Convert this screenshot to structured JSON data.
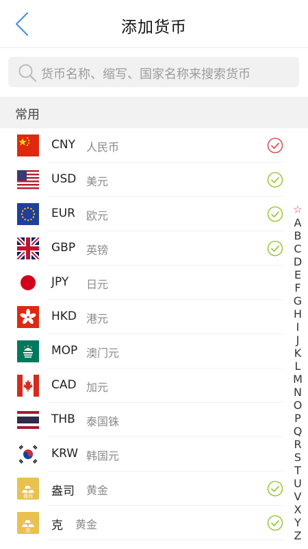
{
  "header": {
    "title": "添加货币"
  },
  "search": {
    "placeholder": "货币名称、缩写、国家名称来搜索货币"
  },
  "section": {
    "common_label": "常用"
  },
  "currencies": [
    {
      "code": "CNY",
      "name": "人民币",
      "flag": "cn-flag-icon",
      "selected": true,
      "check_color": "#d9534f"
    },
    {
      "code": "USD",
      "name": "美元",
      "flag": "us-flag-icon",
      "selected": true,
      "check_color": "#9cc93f"
    },
    {
      "code": "EUR",
      "name": "欧元",
      "flag": "eu-flag-icon",
      "selected": true,
      "check_color": "#9cc93f"
    },
    {
      "code": "GBP",
      "name": "英镑",
      "flag": "gb-flag-icon",
      "selected": true,
      "check_color": "#9cc93f"
    },
    {
      "code": "JPY",
      "name": "日元",
      "flag": "jp-flag-icon",
      "selected": false
    },
    {
      "code": "HKD",
      "name": "港元",
      "flag": "hk-flag-icon",
      "selected": false
    },
    {
      "code": "MOP",
      "name": "澳门元",
      "flag": "mo-flag-icon",
      "selected": false
    },
    {
      "code": "CAD",
      "name": "加元",
      "flag": "ca-flag-icon",
      "selected": false
    },
    {
      "code": "THB",
      "name": "泰国铢",
      "flag": "th-flag-icon",
      "selected": false
    },
    {
      "code": "KRW",
      "name": "韩国元",
      "flag": "kr-flag-icon",
      "selected": false
    },
    {
      "code": "盎司",
      "name": "黄金",
      "flag": "gold-bar-icon",
      "badge": "盎司",
      "selected": true,
      "check_color": "#9cc93f"
    },
    {
      "code": "克",
      "name": "黄金",
      "flag": "gold-bar-icon",
      "badge": "克",
      "selected": true,
      "check_color": "#9cc93f"
    }
  ],
  "index_bar": {
    "star": "☆",
    "letters": [
      "A",
      "B",
      "C",
      "D",
      "E",
      "F",
      "G",
      "H",
      "I",
      "J",
      "K",
      "L",
      "M",
      "N",
      "O",
      "P",
      "Q",
      "R",
      "S",
      "T",
      "U",
      "V",
      "X",
      "Y",
      "Z"
    ]
  },
  "colors": {
    "accent": "#4a90d9",
    "check_red": "#d9534f",
    "check_green": "#9cc93f"
  }
}
